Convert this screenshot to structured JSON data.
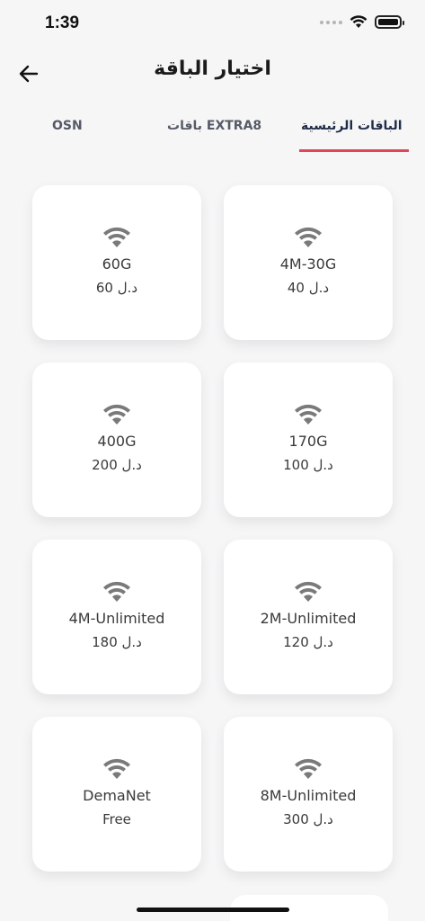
{
  "status_bar": {
    "time": "1:39"
  },
  "header": {
    "title": "اختيار الباقة"
  },
  "tabs": [
    {
      "label": "OSN"
    },
    {
      "label": "باقات EXTRA8"
    },
    {
      "label": "الباقات الرئيسية",
      "active": true
    }
  ],
  "packages": [
    {
      "name": "4M-30G",
      "price": "40 د.ل"
    },
    {
      "name": "60G",
      "price": "60 د.ل"
    },
    {
      "name": "170G",
      "price": "100 د.ل"
    },
    {
      "name": "400G",
      "price": "200 د.ل"
    },
    {
      "name": "2M-Unlimited",
      "price": "120 د.ل"
    },
    {
      "name": "4M-Unlimited",
      "price": "180 د.ل"
    },
    {
      "name": "8M-Unlimited",
      "price": "300 د.ل"
    },
    {
      "name": "DemaNet",
      "price": "Free"
    }
  ],
  "colors": {
    "accent": "#e14656",
    "active_tab": "#1f2c48",
    "icon": "#7a7a7a"
  },
  "icons": {
    "back": "arrow-left-icon",
    "package": "wifi-icon"
  }
}
